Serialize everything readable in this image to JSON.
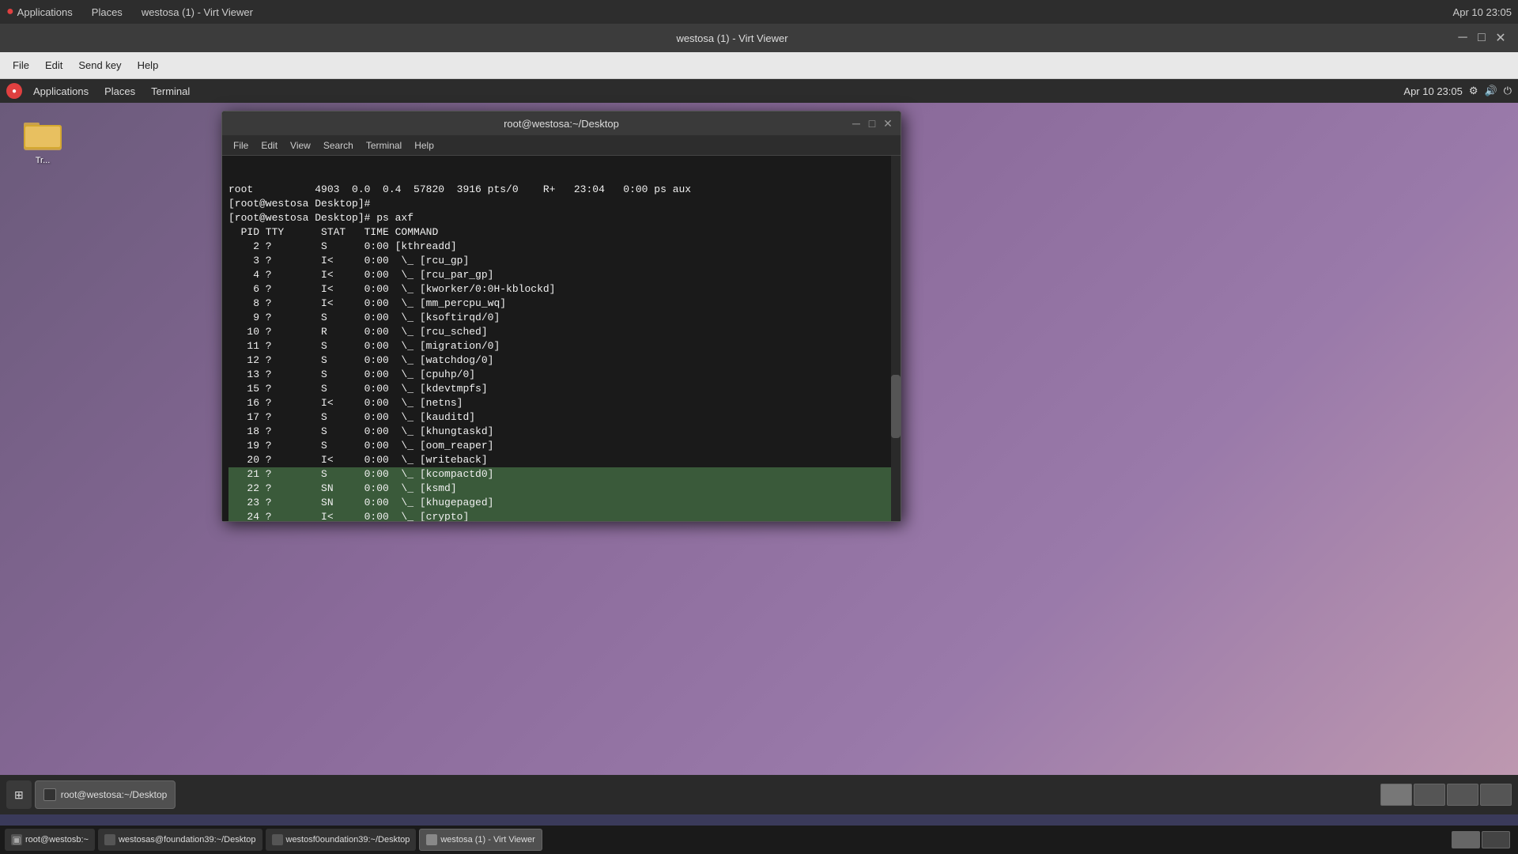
{
  "host": {
    "topbar": {
      "app_label": "Applications",
      "places_label": "Places",
      "title": "westosa (1) - Virt Viewer",
      "datetime": "Apr 10  23:05"
    },
    "menubar": {
      "file_label": "File",
      "edit_label": "Edit",
      "sendkey_label": "Send key",
      "help_label": "Help"
    },
    "taskbar": {
      "items": [
        {
          "label": "root@westosb:~",
          "active": false
        },
        {
          "label": "westosas@foundation39:~/Desktop",
          "active": false
        },
        {
          "label": "westosf0oundation39:~/Desktop",
          "active": false
        },
        {
          "label": "westosa (1) - Virt Viewer",
          "active": true
        }
      ]
    }
  },
  "virt_viewer": {
    "title": "westosa (1) - Virt Viewer"
  },
  "vm": {
    "toppanel": {
      "applications_label": "Applications",
      "places_label": "Places",
      "terminal_label": "Terminal",
      "datetime": "Apr 10  23:05"
    },
    "folder_label": "Tr...",
    "terminal": {
      "title": "root@westosa:~/Desktop",
      "menubar": {
        "file": "File",
        "edit": "Edit",
        "view": "View",
        "search": "Search",
        "terminal": "Terminal",
        "help": "Help"
      },
      "content_lines": [
        {
          "text": "root          4903  0.0  0.4  57820  3916 pts/0    R+   23:04   0:00 ps aux",
          "selected": false
        },
        {
          "text": "[root@westosa Desktop]# ",
          "selected": false
        },
        {
          "text": "[root@westosa Desktop]# ps axf",
          "selected": false
        },
        {
          "text": "  PID TTY      STAT   TIME COMMAND",
          "selected": false
        },
        {
          "text": "    2 ?        S      0:00 [kthreadd]",
          "selected": false
        },
        {
          "text": "    3 ?        I<     0:00  \\_ [rcu_gp]",
          "selected": false
        },
        {
          "text": "    4 ?        I<     0:00  \\_ [rcu_par_gp]",
          "selected": false
        },
        {
          "text": "    6 ?        I<     0:00  \\_ [kworker/0:0H-kblockd]",
          "selected": false
        },
        {
          "text": "    8 ?        I<     0:00  \\_ [mm_percpu_wq]",
          "selected": false
        },
        {
          "text": "    9 ?        S      0:00  \\_ [ksoftirqd/0]",
          "selected": false
        },
        {
          "text": "   10 ?        R      0:00  \\_ [rcu_sched]",
          "selected": false
        },
        {
          "text": "   11 ?        S      0:00  \\_ [migration/0]",
          "selected": false
        },
        {
          "text": "   12 ?        S      0:00  \\_ [watchdog/0]",
          "selected": false
        },
        {
          "text": "   13 ?        S      0:00  \\_ [cpuhp/0]",
          "selected": false
        },
        {
          "text": "   15 ?        S      0:00  \\_ [kdevtmpfs]",
          "selected": false
        },
        {
          "text": "   16 ?        I<     0:00  \\_ [netns]",
          "selected": false
        },
        {
          "text": "   17 ?        S      0:00  \\_ [kauditd]",
          "selected": false
        },
        {
          "text": "   18 ?        S      0:00  \\_ [khungtaskd]",
          "selected": false
        },
        {
          "text": "   19 ?        S      0:00  \\_ [oom_reaper]",
          "selected": false
        },
        {
          "text": "   20 ?        I<     0:00  \\_ [writeback]",
          "selected": false
        },
        {
          "text": "   21 ?        S      0:00  \\_ [kcompactd0]",
          "selected": true
        },
        {
          "text": "   22 ?        SN     0:00  \\_ [ksmd]",
          "selected": true
        },
        {
          "text": "   23 ?        SN     0:00  \\_ [khugepaged]",
          "selected": true
        },
        {
          "text": "   24 ?        I<     0:00  \\_ [crypto]",
          "selected": true
        }
      ]
    },
    "taskbar": {
      "items": [
        {
          "label": "root@westosa:~/Desktop",
          "active": true
        }
      ]
    }
  },
  "icons": {
    "minimize": "─",
    "maximize": "□",
    "close": "✕",
    "terminal": "▣",
    "folder": "📁"
  }
}
